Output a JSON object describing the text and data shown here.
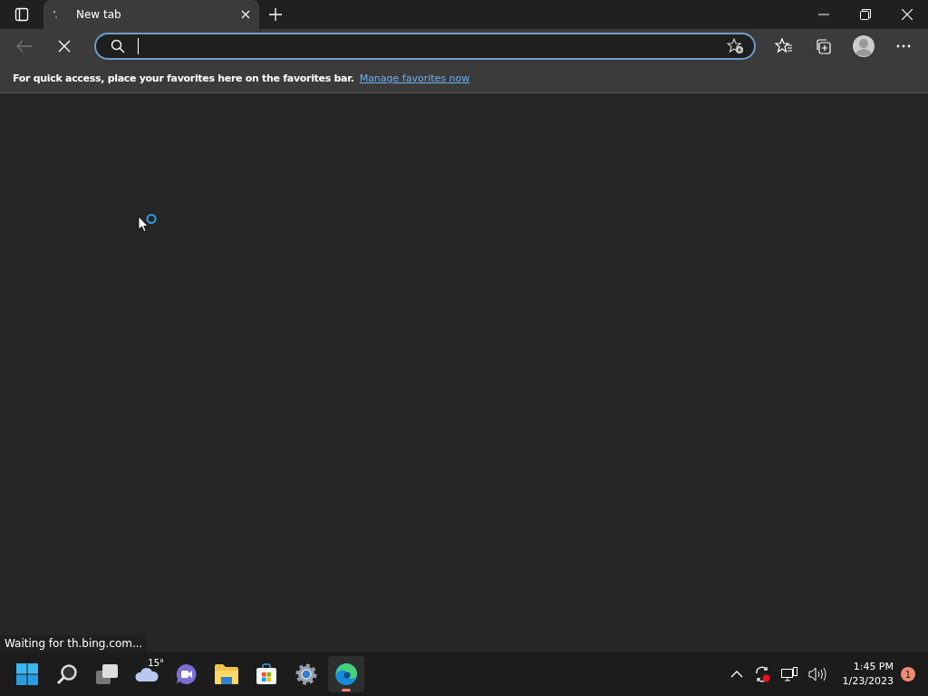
{
  "tabs": [
    {
      "title": "New tab",
      "selected": true
    }
  ],
  "favorites_bar": {
    "message": "For quick access, place your favorites here on the favorites bar.",
    "link": "Manage favorites now"
  },
  "status_bar": {
    "text": "Waiting for th.bing.com..."
  },
  "taskbar": {
    "apps": [
      {
        "kind": "start",
        "selected": false
      },
      {
        "kind": "search",
        "selected": false
      },
      {
        "kind": "taskview",
        "selected": false
      },
      {
        "kind": "weather",
        "selected": false,
        "label": "15°"
      },
      {
        "kind": "chat",
        "selected": false
      },
      {
        "kind": "explorer",
        "selected": false
      },
      {
        "kind": "store",
        "selected": false
      },
      {
        "kind": "settings",
        "selected": false
      },
      {
        "kind": "edge",
        "selected": true
      }
    ],
    "clock": {
      "time": "1:45 PM",
      "date": "1/23/2023"
    },
    "notifications": "1"
  }
}
